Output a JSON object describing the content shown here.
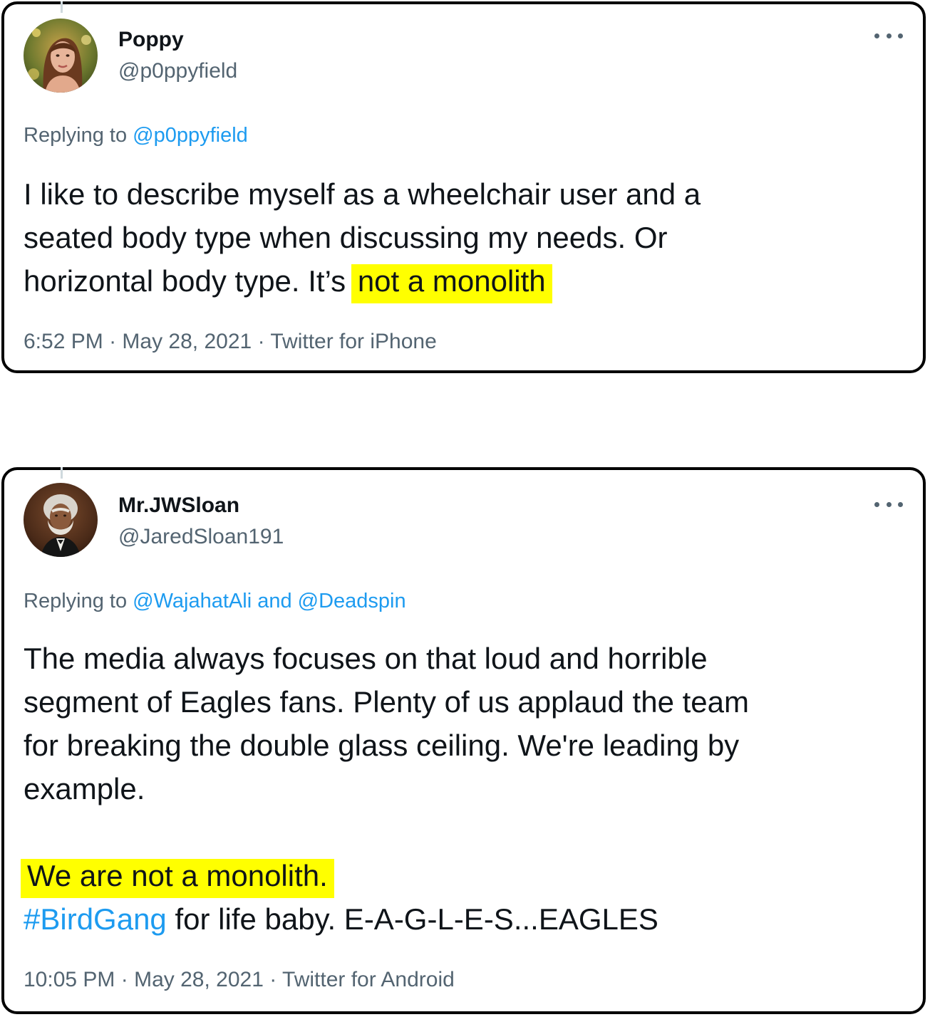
{
  "tweets": [
    {
      "name": "Poppy",
      "handle": "@p0ppyfield",
      "replying_prefix": "Replying to",
      "replying_to": [
        "@p0ppyfield"
      ],
      "text_lines": [
        "I like to describe myself as a wheelchair user and a",
        "seated body type when discussing my needs. Or"
      ],
      "text_line3_before": "horizontal body type. It’s",
      "text_line3_highlight": "not a monolith",
      "time": "6:52 PM",
      "date": "May 28, 2021",
      "source": "Twitter for iPhone",
      "separator": "·",
      "highlight_color": "#ffff00"
    },
    {
      "name": "Mr.JWSloan",
      "handle": "@JaredSloan191",
      "replying_prefix": "Replying to",
      "replying_to": [
        "@WajahatAli",
        "@Deadspin"
      ],
      "replying_joiner": "and",
      "text_lines": [
        "The media always focuses on that loud and horrible",
        "segment of Eagles fans.  Plenty of us applaud the team",
        "for breaking the double glass ceiling. We're leading by",
        "example."
      ],
      "highlight_line": "We are not a monolith.",
      "hashtag": "#BirdGang",
      "hashtag_line_rest": "for life baby. E-A-G-L-E-S...EAGLES",
      "time": "10:05 PM",
      "date": "May 28, 2021",
      "source": "Twitter for Android",
      "separator": "·",
      "highlight_color": "#ffff00"
    }
  ],
  "colors": {
    "link": "#1d9bf0",
    "secondary_text": "#536471",
    "primary_text": "#0f1419",
    "card_border": "#000000"
  },
  "icons": {
    "more": "more-horizontal-icon"
  }
}
